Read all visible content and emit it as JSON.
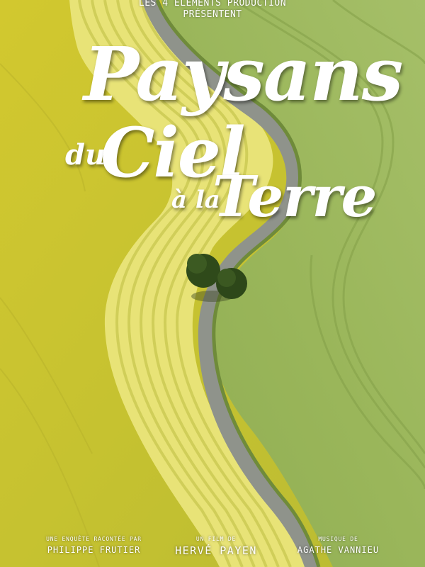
{
  "header": {
    "production_line1": "LES 4 ELEMENTS PRODUCTION",
    "production_line2": "PRÉSENTENT"
  },
  "title": {
    "word1": "Paysans",
    "word2": "du",
    "word3": "Ciel",
    "word4": "à la",
    "word5": "Terre"
  },
  "credits": [
    {
      "role": "UNE ENQUÊTE RACONTÉE PAR",
      "name": "PHILIPPE FRUTIER"
    },
    {
      "role": "UN FILM DE",
      "name": "HERVÉ PAYEN"
    },
    {
      "role": "MUSIQUE DE",
      "name": "AGATHE VANNIEU"
    }
  ],
  "colors": {
    "yellow_field": "#c8c431",
    "green_field": "#9cb85c",
    "road": "#8e9188",
    "text": "#ffffff"
  }
}
